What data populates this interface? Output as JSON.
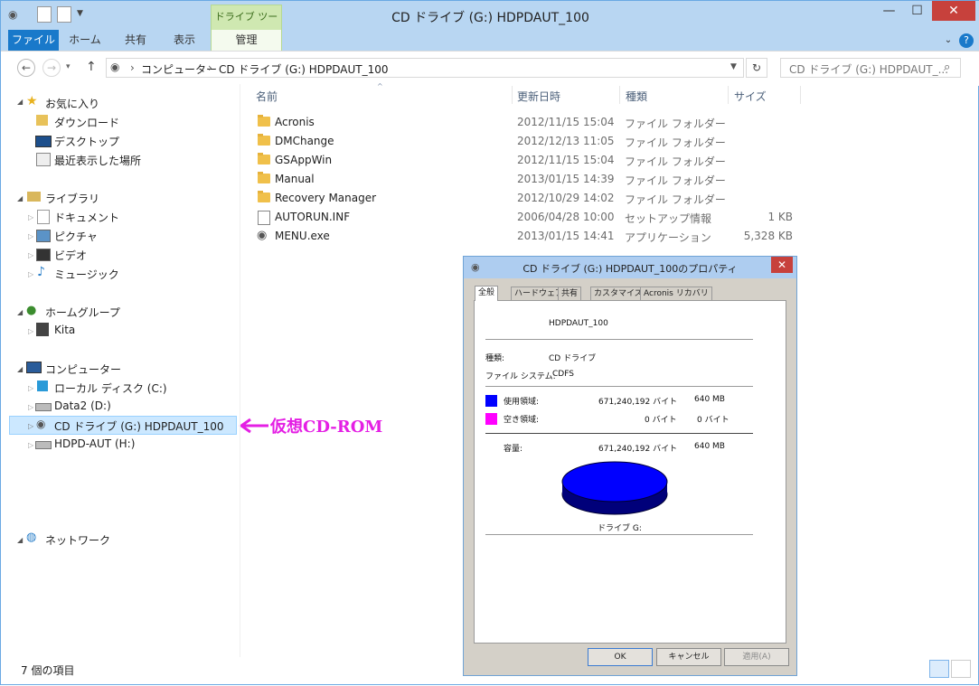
{
  "window": {
    "title": "CD ドライブ (G:) HDPDAUT_100",
    "contextual_tab_group": "ドライブ ツール",
    "minimize": "—",
    "maximize": "☐",
    "close": "✕"
  },
  "ribbon": {
    "tabs": [
      "ファイル",
      "ホーム",
      "共有",
      "表示",
      "管理"
    ],
    "help": "?"
  },
  "address": {
    "back": "←",
    "forward": "→",
    "up": "↑",
    "path": [
      "コンピューター",
      "CD ドライブ (G:) HDPDAUT_100"
    ],
    "separator": "›",
    "refresh": "↻",
    "search_placeholder": "CD ドライブ (G:) HDPDAUT_..."
  },
  "nav": {
    "favorites": {
      "label": "お気に入り",
      "items": [
        "ダウンロード",
        "デスクトップ",
        "最近表示した場所"
      ]
    },
    "libraries": {
      "label": "ライブラリ",
      "items": [
        "ドキュメント",
        "ピクチャ",
        "ビデオ",
        "ミュージック"
      ]
    },
    "homegroup": {
      "label": "ホームグループ",
      "items": [
        "Kita"
      ]
    },
    "computer": {
      "label": "コンピューター",
      "items": [
        "ローカル ディスク (C:)",
        "Data2 (D:)",
        "CD ドライブ (G:) HDPDAUT_100",
        "HDPD-AUT (H:)"
      ]
    },
    "network": {
      "label": "ネットワーク"
    }
  },
  "columns": {
    "name": "名前",
    "date": "更新日時",
    "type": "種類",
    "size": "サイズ"
  },
  "files": [
    {
      "name": "Acronis",
      "date": "2012/11/15 15:04",
      "type": "ファイル フォルダー",
      "size": ""
    },
    {
      "name": "DMChange",
      "date": "2012/12/13 11:05",
      "type": "ファイル フォルダー",
      "size": ""
    },
    {
      "name": "GSAppWin",
      "date": "2012/11/15 15:04",
      "type": "ファイル フォルダー",
      "size": ""
    },
    {
      "name": "Manual",
      "date": "2013/01/15 14:39",
      "type": "ファイル フォルダー",
      "size": ""
    },
    {
      "name": "Recovery Manager",
      "date": "2012/10/29 14:02",
      "type": "ファイル フォルダー",
      "size": ""
    },
    {
      "name": "AUTORUN.INF",
      "date": "2006/04/28 10:00",
      "type": "セットアップ情報",
      "size": "1 KB"
    },
    {
      "name": "MENU.exe",
      "date": "2013/01/15 14:41",
      "type": "アプリケーション",
      "size": "5,328 KB"
    }
  ],
  "status": {
    "item_count": "7 個の項目"
  },
  "annotation": "仮想CD-ROM",
  "dialog": {
    "title": "CD ドライブ (G:) HDPDAUT_100のプロパティ",
    "close": "✕",
    "tabs": [
      "全般",
      "ハードウェア",
      "共有",
      "カスタマイズ",
      "Acronis リカバリ"
    ],
    "volume_label": "HDPDAUT_100",
    "type_label": "種類:",
    "type_value": "CD ドライブ",
    "fs_label": "ファイル システム:",
    "fs_value": "CDFS",
    "used_label": "使用領域:",
    "used_bytes": "671,240,192 バイト",
    "used_mb": "640 MB",
    "free_label": "空き領域:",
    "free_bytes": "0 バイト",
    "free_mb": "0 バイト",
    "capacity_label": "容量:",
    "capacity_bytes": "671,240,192 バイト",
    "capacity_mb": "640 MB",
    "drive_label": "ドライブ G:",
    "used_color": "#0000ff",
    "free_color": "#ff00ff",
    "used_fraction": 1.0,
    "ok": "OK",
    "cancel": "キャンセル",
    "apply": "適用(A)"
  }
}
